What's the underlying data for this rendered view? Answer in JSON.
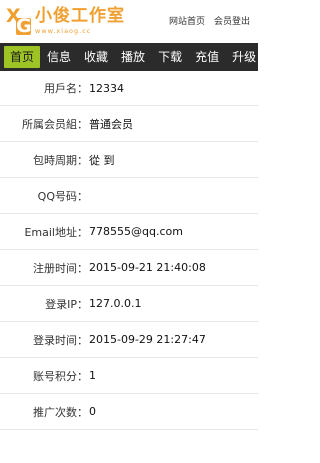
{
  "header": {
    "logo_mark_x": "X",
    "logo_mark_g": "G",
    "logo_title": "小俊工作室",
    "logo_url": "www.xiaog.cc",
    "links": [
      "网站首页",
      "会员登出"
    ]
  },
  "nav": {
    "items": [
      "首页",
      "信息",
      "收藏",
      "播放",
      "下载",
      "充值",
      "升级"
    ],
    "active_index": 0
  },
  "profile": [
    {
      "label": "用戶名：",
      "value": "12334"
    },
    {
      "label": "所属会员組：",
      "value": "普通会员"
    },
    {
      "label": "包時周期：",
      "value": "從 到"
    },
    {
      "label": "QQ号码：",
      "value": ""
    },
    {
      "label": "Email地址：",
      "value": "778555@qq.com"
    },
    {
      "label": "注册时间：",
      "value": "2015-09-21 21:40:08"
    },
    {
      "label": "登录IP：",
      "value": "127.0.0.1"
    },
    {
      "label": "登录时间：",
      "value": "2015-09-29 21:27:47"
    },
    {
      "label": "账号积分：",
      "value": "1"
    },
    {
      "label": "推广次数：",
      "value": "0"
    }
  ],
  "colors": {
    "brand": "#f0a030",
    "nav_bg": "#2b2b2b",
    "nav_active": "#9dc324"
  }
}
